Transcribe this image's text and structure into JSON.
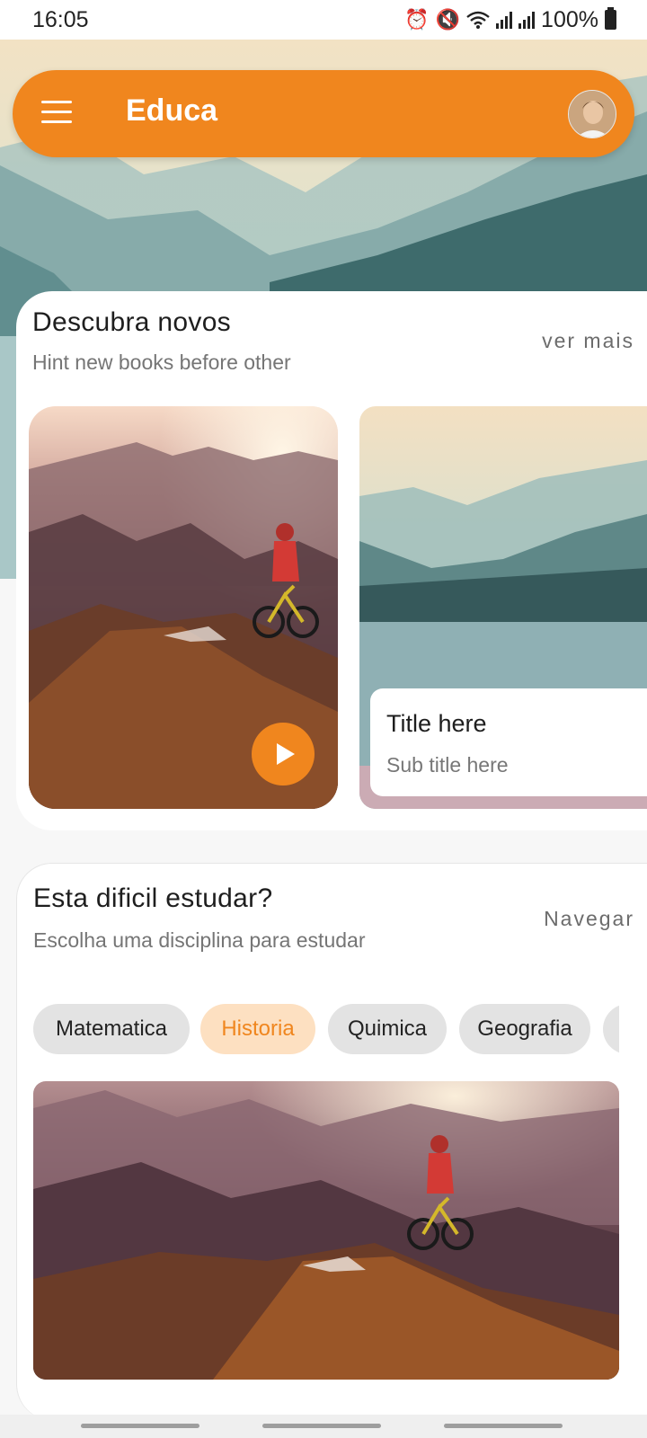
{
  "status_bar": {
    "time": "16:05",
    "battery": "100%",
    "icons": [
      "alarm-icon",
      "mute-icon",
      "wifi-icon",
      "signal-icon",
      "signal-icon",
      "battery-icon"
    ]
  },
  "app_bar": {
    "title": "Educa",
    "menu_icon": "menu-icon",
    "avatar": "avatar"
  },
  "discover": {
    "title": "Descubra novos",
    "subtitle": "Hint new books before other",
    "action": "ver mais",
    "cards": [
      {
        "image": "mountain-biker",
        "play_icon": "play-icon"
      },
      {
        "image": "mountain-lake",
        "title": "Title here",
        "subtitle": "Sub title here"
      }
    ]
  },
  "study": {
    "title": "Esta dificil estudar?",
    "subtitle": "Escolha uma disciplina para estudar",
    "action": "Navegar",
    "chips": [
      {
        "label": "Matematica",
        "active": false
      },
      {
        "label": "Historia",
        "active": true
      },
      {
        "label": "Quimica",
        "active": false
      },
      {
        "label": "Geografia",
        "active": false
      }
    ],
    "image": "mountain-biker"
  },
  "colors": {
    "accent": "#f0861e",
    "chip_active_bg": "#fde0c1",
    "chip_bg": "#e3e3e3"
  }
}
